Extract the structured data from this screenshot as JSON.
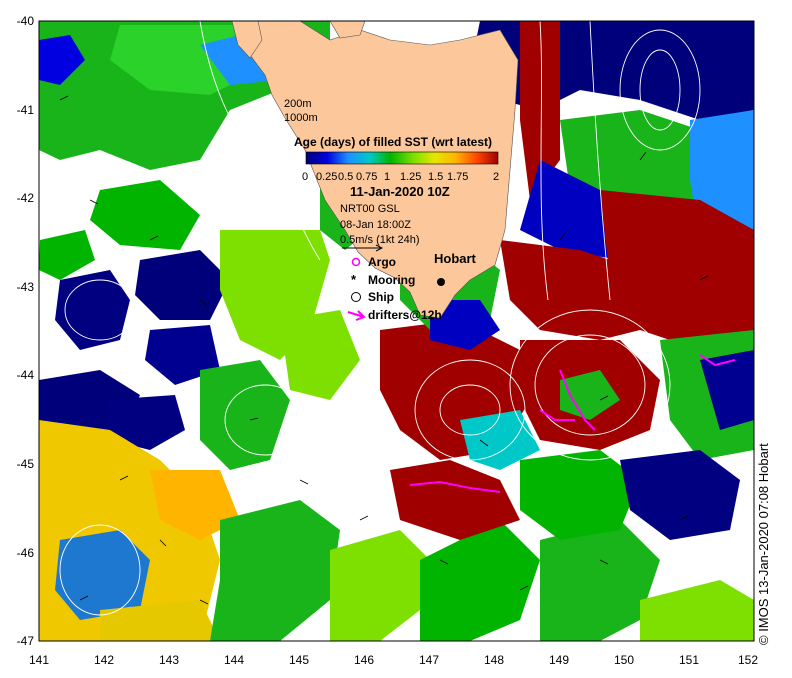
{
  "map": {
    "lon_ticks": [
      "141",
      "142",
      "143",
      "144",
      "145",
      "146",
      "147",
      "148",
      "149",
      "150",
      "151",
      "152"
    ],
    "lat_ticks": [
      "-40",
      "-41",
      "-42",
      "-43",
      "-44",
      "-45",
      "-46",
      "-47"
    ],
    "extent": {
      "lon": [
        141,
        152
      ],
      "lat": [
        -47,
        -40
      ]
    },
    "land_color": "#fcc89b",
    "ocean_no_data_color": "#ffffff"
  },
  "legend": {
    "depth_contours": [
      "200m",
      "1000m"
    ],
    "colorbar_title": "Age (days) of filled SST (wrt latest)",
    "colorbar_ticks": [
      "0",
      "0.25",
      "0.5",
      "0.75",
      "1",
      "1.25",
      "1.5",
      "1.75",
      "2"
    ],
    "colorbar_range": [
      0,
      2
    ],
    "colorbar_colors": [
      "#00007a",
      "#0000e0",
      "#1e90ff",
      "#00c8c8",
      "#00b400",
      "#7de000",
      "#e6e600",
      "#ffb400",
      "#ff4500",
      "#a00000"
    ],
    "date": "11-Jan-2020 10Z",
    "current_product": "NRT00 GSL",
    "current_time": "08-Jan 18:00Z",
    "scale_label": "0.5m/s (1kt 24h)",
    "symbols": {
      "argo": "Argo",
      "mooring": "Mooring",
      "ship": "Ship",
      "drifters": "drifters@12h"
    },
    "symbol_colors": {
      "argo": "#ff00ff",
      "drifters": "#ff00ff"
    }
  },
  "places": {
    "hobart": "Hobart"
  },
  "credit": "© IMOS 13-Jan-2020 07:08 Hobart"
}
